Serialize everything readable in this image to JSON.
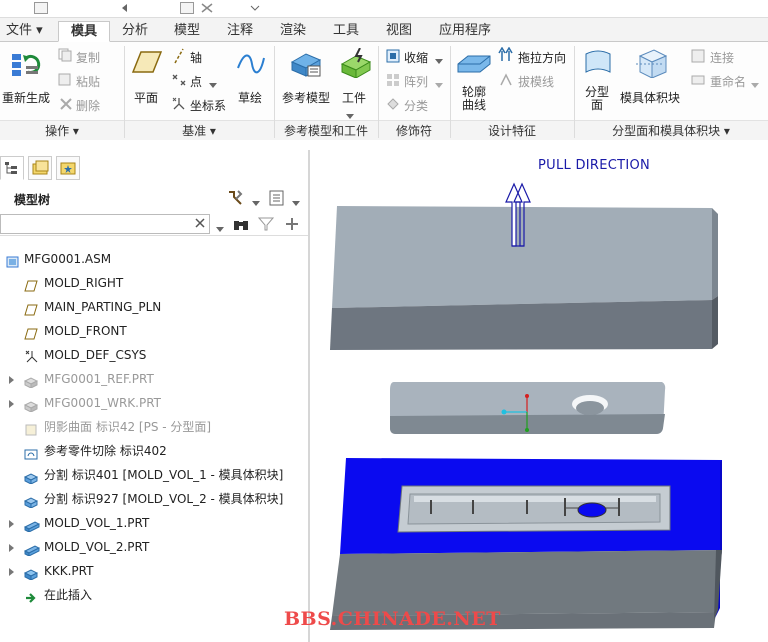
{
  "menu": {
    "tabs": [
      {
        "label": "文件 ▾"
      },
      {
        "label": "模具"
      },
      {
        "label": "分析"
      },
      {
        "label": "模型"
      },
      {
        "label": "注释"
      },
      {
        "label": "渲染"
      },
      {
        "label": "工具"
      },
      {
        "label": "视图"
      },
      {
        "label": "应用程序"
      }
    ]
  },
  "ribbon": {
    "regenerate": "重新生成",
    "copy": "复制",
    "paste": "粘贴",
    "delete": "删除",
    "plane": "平面",
    "axis": "轴",
    "point": "点",
    "csys": "坐标系",
    "sketch": "草绘",
    "ref_model": "参考模型",
    "workpiece": "工件",
    "shrink": "收缩",
    "pattern": "阵列",
    "classify": "分类",
    "silhouette_l1": "轮廓",
    "silhouette_l2": "曲线",
    "pull_direction": "拖拉方向",
    "draft_line": "拔模线",
    "parting_surf_l1": "分型",
    "parting_surf_l2": "面",
    "mold_volume": "模具体积块",
    "connect": "连接",
    "rename": "重命名",
    "groups": {
      "operations": "操作 ▾",
      "datum": "基准 ▾",
      "ref_work": "参考模型和工件",
      "modifiers": "修饰符",
      "design_features": "设计特征",
      "parting": "分型面和模具体积块 ▾"
    }
  },
  "panel": {
    "title": "模型树",
    "search_value": ""
  },
  "tree": [
    {
      "label": "MFG0001.ASM",
      "dim": false,
      "expand": false,
      "icon": "assembly-icon"
    },
    {
      "label": "MOLD_RIGHT",
      "dim": false,
      "expand": false,
      "icon": "datum-plane-icon"
    },
    {
      "label": "MAIN_PARTING_PLN",
      "dim": false,
      "expand": false,
      "icon": "datum-plane-icon"
    },
    {
      "label": "MOLD_FRONT",
      "dim": false,
      "expand": false,
      "icon": "datum-plane-icon"
    },
    {
      "label": "MOLD_DEF_CSYS",
      "dim": false,
      "expand": false,
      "icon": "csys-icon"
    },
    {
      "label": "MFG0001_REF.PRT",
      "dim": true,
      "expand": true,
      "icon": "part-icon"
    },
    {
      "label": "MFG0001_WRK.PRT",
      "dim": true,
      "expand": true,
      "icon": "part-icon"
    },
    {
      "label": "阴影曲面 标识42 [PS - 分型面]",
      "dim": true,
      "expand": false,
      "icon": "shadow-surface-icon"
    },
    {
      "label": "参考零件切除 标识402",
      "dim": false,
      "expand": false,
      "icon": "ref-cut-icon"
    },
    {
      "label": "分割 标识401 [MOLD_VOL_1 - 模具体积块]",
      "dim": false,
      "expand": false,
      "icon": "split-icon"
    },
    {
      "label": "分割 标识927 [MOLD_VOL_2 - 模具体积块]",
      "dim": false,
      "expand": false,
      "icon": "split-icon"
    },
    {
      "label": "MOLD_VOL_1.PRT",
      "dim": false,
      "expand": true,
      "icon": "mold-part-icon"
    },
    {
      "label": "MOLD_VOL_2.PRT",
      "dim": false,
      "expand": true,
      "icon": "mold-part-icon"
    },
    {
      "label": "KKK.PRT",
      "dim": false,
      "expand": true,
      "icon": "part-blue-icon"
    },
    {
      "label": "在此插入",
      "dim": false,
      "expand": false,
      "icon": "insert-here-icon"
    }
  ],
  "viewport": {
    "pull_direction_label": "PULL DIRECTION",
    "watermark": "BBS.CHINADE.NET",
    "colors": {
      "plate_gray": "#9aa4ae",
      "cavity_blue": "#0a0af0",
      "arrow_blue": "#1a1aa8"
    }
  }
}
